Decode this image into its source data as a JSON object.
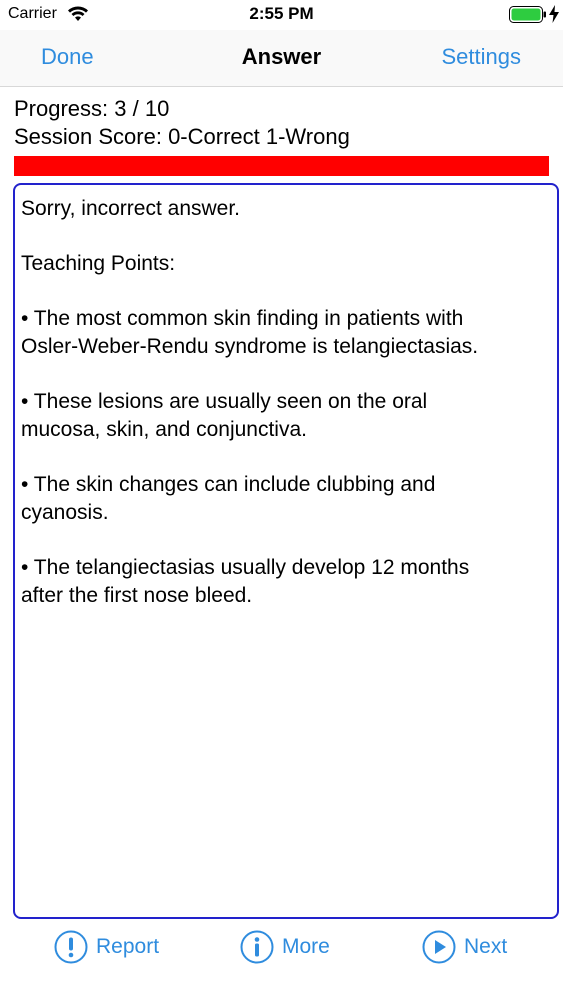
{
  "status_bar": {
    "carrier": "Carrier",
    "time": "2:55 PM",
    "icons": [
      "wifi-icon",
      "battery-icon",
      "charging-icon"
    ]
  },
  "nav": {
    "left_label": "Done",
    "title": "Answer",
    "right_label": "Settings"
  },
  "progress": {
    "progress_text": "Progress: 3 / 10",
    "score_text": "Session Score: 0-Correct 1-Wrong",
    "bar_fill_fraction": 1.0,
    "bar_color": "#ff0000"
  },
  "answer": {
    "result": "Sorry, incorrect answer.",
    "heading": "Teaching Points:",
    "points": [
      {
        "line1": "• The most common skin finding in patients with",
        "line2": "Osler-Weber-Rendu syndrome is telangiectasias."
      },
      {
        "line1": "• These lesions are usually seen on the oral",
        "line2": "mucosa, skin, and conjunctiva."
      },
      {
        "line1": "• The skin changes can include clubbing and",
        "line2": "cyanosis."
      },
      {
        "line1": "• The telangiectasias usually develop 12 months",
        "line2": "after the first nose bleed."
      }
    ]
  },
  "toolbar": {
    "report_label": "Report",
    "more_label": "More",
    "next_label": "Next"
  },
  "colors": {
    "accent": "#2f8cde",
    "box_border": "#2222cc",
    "progress": "#ff0000"
  }
}
